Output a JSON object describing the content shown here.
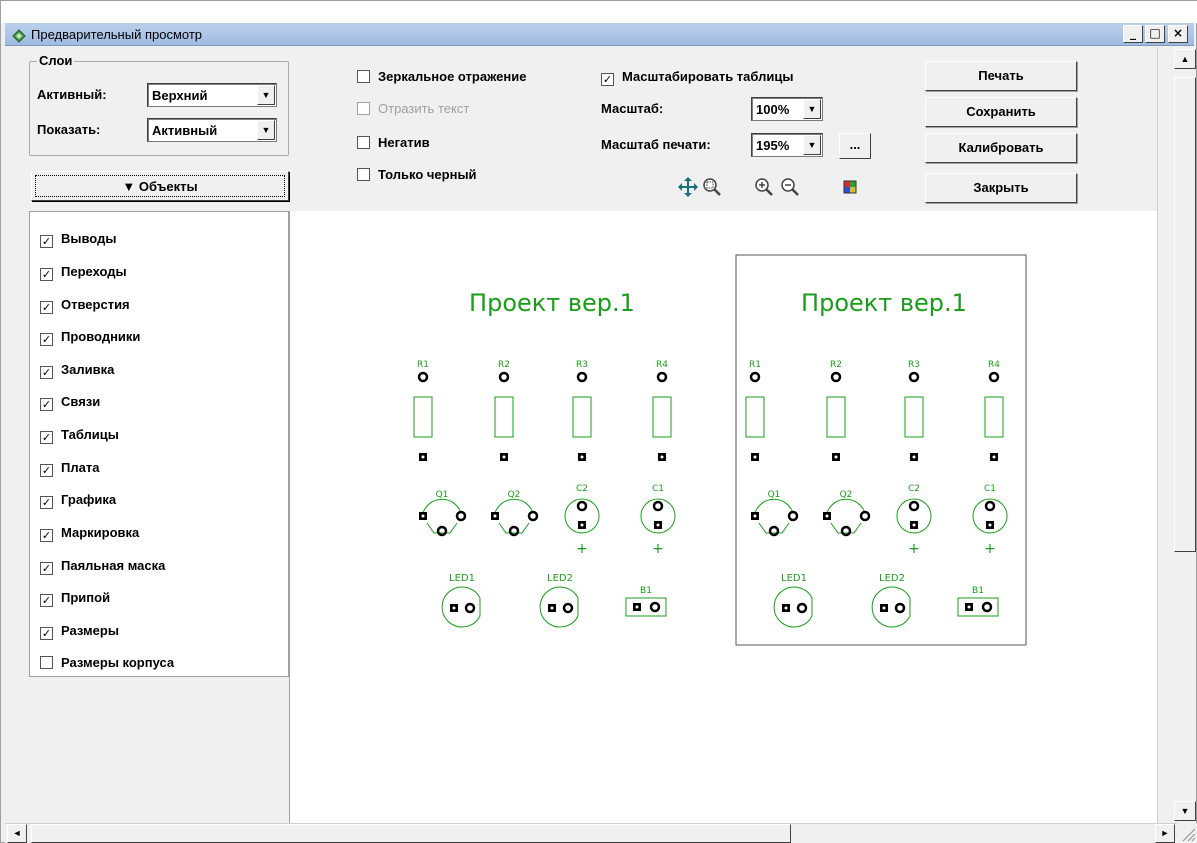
{
  "window": {
    "title": "Предварительный просмотр",
    "controls": [
      "_",
      "□",
      "×"
    ]
  },
  "layers": {
    "group_title": "Слои",
    "active_label": "Активный:",
    "active_value": "Верхний",
    "show_label": "Показать:",
    "show_value": "Активный"
  },
  "objects_button": "▼ Объекты",
  "objects": [
    {
      "label": "Выводы",
      "checked": true
    },
    {
      "label": "Переходы",
      "checked": true
    },
    {
      "label": "Отверстия",
      "checked": true
    },
    {
      "label": "Проводники",
      "checked": true
    },
    {
      "label": "Заливка",
      "checked": true
    },
    {
      "label": "Связи",
      "checked": true
    },
    {
      "label": "Таблицы",
      "checked": true
    },
    {
      "label": "Плата",
      "checked": true
    },
    {
      "label": "Графика",
      "checked": true
    },
    {
      "label": "Маркировка",
      "checked": true
    },
    {
      "label": "Паяльная маска",
      "checked": true
    },
    {
      "label": "Припой",
      "checked": true
    },
    {
      "label": "Размеры",
      "checked": true
    },
    {
      "label": "Размеры корпуса",
      "checked": false
    }
  ],
  "options": {
    "mirror": {
      "label": "Зеркальное отражение",
      "checked": false
    },
    "mirror_text": {
      "label": "Отразить текст",
      "checked": false,
      "disabled": true
    },
    "negative": {
      "label": "Негатив",
      "checked": false
    },
    "black_only": {
      "label": "Только черный",
      "checked": false
    },
    "scale_tables": {
      "label": "Масштабировать таблицы",
      "checked": true
    },
    "scale_label": "Масштаб:",
    "scale_value": "100%",
    "print_scale_label": "Масштаб печати:",
    "print_scale_value": "195%",
    "more_button": "..."
  },
  "buttons": {
    "print": "Печать",
    "save": "Сохранить",
    "calibrate": "Калибровать",
    "close": "Закрыть"
  },
  "toolbar_icons": [
    "move-icon",
    "zoom-window-icon",
    "zoom-in-icon",
    "zoom-out-icon",
    "color-palette-icon"
  ],
  "preview": {
    "board_title": "Проект вер.1",
    "resistors": [
      "R1",
      "R2",
      "R3",
      "R4"
    ],
    "transistors": [
      "Q1",
      "Q2"
    ],
    "capacitors": [
      "C2",
      "C1"
    ],
    "plus_sign": "+",
    "leds": [
      "LED1",
      "LED2"
    ],
    "battery": "B1",
    "colors": {
      "copper": "#1a9e1a",
      "pads": "#000000",
      "board_outline": "#555555"
    }
  }
}
